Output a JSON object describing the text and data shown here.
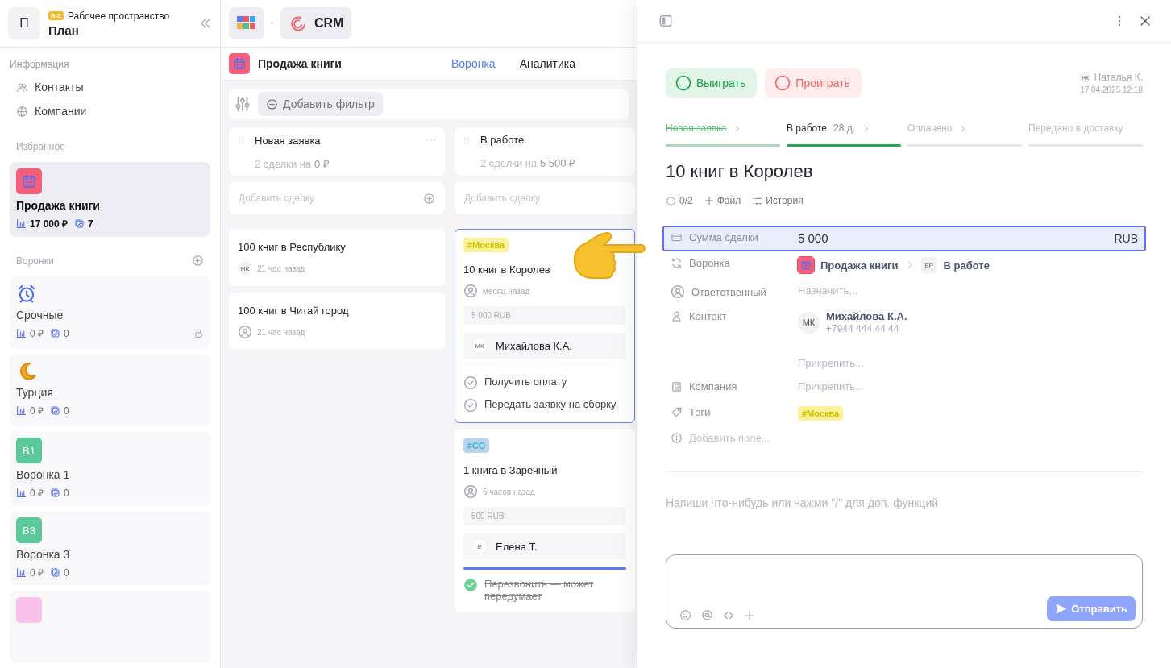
{
  "sidebar": {
    "workspace": {
      "avatar": "П",
      "badge": "BIZ",
      "label": "Рабочее пространство",
      "name": "План"
    },
    "info": {
      "title": "Информация",
      "items": [
        {
          "label": "Контакты",
          "kind": "contacts"
        },
        {
          "label": "Компании",
          "kind": "companies"
        }
      ]
    },
    "favorites": {
      "title": "Избранное",
      "items": [
        {
          "name": "Продажа книги",
          "kind": "calendar",
          "amount": "17 000 ₽",
          "count": "7",
          "selected": true,
          "locked": false
        }
      ]
    },
    "funnels": {
      "title": "Воронки",
      "items": [
        {
          "name": "Срочные",
          "kind": "alarm",
          "amount": "0 ₽",
          "count": "0",
          "selected": false,
          "locked": true
        },
        {
          "name": "Турция",
          "kind": "moon",
          "amount": "0 ₽",
          "count": "0",
          "selected": false,
          "locked": false
        },
        {
          "name": "Воронка 1",
          "kind": "badge",
          "badge": "В1",
          "color": "#5cc99a",
          "amount": "0 ₽",
          "count": "0",
          "selected": false,
          "locked": false
        },
        {
          "name": "Воронка 3",
          "kind": "badge",
          "badge": "В3",
          "color": "#5cc99a",
          "amount": "0 ₽",
          "count": "0",
          "selected": false,
          "locked": false
        },
        {
          "kind": "badge",
          "color": "#f9c0ec"
        }
      ]
    }
  },
  "topbar": {
    "crumb": "CRM"
  },
  "board": {
    "title": "Продажа книги",
    "tabs": [
      {
        "label": "Воронка",
        "selected": true
      },
      {
        "label": "Аналитика",
        "selected": false
      }
    ],
    "filter": "Добавить фильтр",
    "columns": [
      {
        "title": "Новая заявка",
        "summary": "2 сделки на **0 ₽**",
        "add": "Добавить сделку",
        "cards": [
          {
            "title": "100 книг в Республику",
            "initials": "НК",
            "time": "21 час назад",
            "selected": false
          },
          {
            "title": "100 книг в Читай город",
            "time": "21 час назад",
            "selected": false
          }
        ]
      },
      {
        "title": "В работе",
        "summary": "2 сделки на **5 500 ₽**",
        "add": "Добавить сделку",
        "cards": [
          {
            "tag": {
              "label": "#Москва",
              "color": "#fff09a"
            },
            "title": "10 книг в Королев",
            "time": "месяц назад",
            "amount": "5 000 RUB",
            "assignee": {
              "initials": "МК",
              "name": "Михайлова К.А."
            },
            "tasks": [
              {
                "label": "Получить оплату",
                "done": false
              },
              {
                "label": "Передать заявку на сборку",
                "done": false
              }
            ],
            "selected": true
          },
          {
            "tag": {
              "label": "#СО",
              "color": "#b8d4ee"
            },
            "title": "1 книга в Заречный",
            "time": "5 часов назад",
            "amount": "500 RUB",
            "assignee": {
              "initials": "Е",
              "name": "Елена Т."
            },
            "level": 1,
            "tasks": [
              {
                "label": "Перезвонить — может передумает",
                "done": true
              }
            ],
            "selected": false
          }
        ]
      }
    ]
  },
  "detail": {
    "actions": [
      {
        "label": "Выиграть",
        "kind": "win"
      },
      {
        "label": "Проиграть",
        "kind": "lose"
      }
    ],
    "author": {
      "initials": "НК",
      "name": "Наталья К.",
      "date": "17.04.2025 12:18"
    },
    "stages": [
      {
        "label": "Новая заявка",
        "done": true,
        "selected": false
      },
      {
        "label": "В работе",
        "duration": "28 д.",
        "done": false,
        "selected": true
      },
      {
        "label": "Оплачено",
        "done": false,
        "selected": false
      },
      {
        "label": "Передано в доставку",
        "done": false,
        "selected": false
      }
    ],
    "title": "10 книг в Королев",
    "meta": {
      "checklist": "0/2",
      "file": "Файл",
      "history": "История"
    },
    "fields": [
      {
        "kind": "amount",
        "label": "Сумма сделки",
        "value": "5 000",
        "currency": "RUB",
        "selected": true
      },
      {
        "kind": "funnel",
        "label": "Воронка",
        "funnel": "Продажа книги",
        "stage_initials": "ВР",
        "stage": "В работе",
        "selected": false
      },
      {
        "kind": "responsible",
        "label": "Ответственный",
        "placeholder": "Назначить...",
        "selected": false
      },
      {
        "kind": "contact",
        "label": "Контакт",
        "initials": "МК",
        "name": "Михайлова К.А.",
        "phone": "+7944 444 44 44",
        "attach": "Прикрепить...",
        "selected": false
      },
      {
        "kind": "company",
        "label": "Компания",
        "placeholder": "Прикрепить..",
        "selected": false
      },
      {
        "kind": "tags",
        "label": "Теги",
        "tag": {
          "label": "#Москва",
          "color": "#fff09a"
        },
        "selected": false
      },
      {
        "kind": "add",
        "label": "Добавить поле...",
        "selected": false
      }
    ],
    "comment_hint": "Напиши что-нибудь или нажми \"/\" для доп. функций",
    "send": "Отправить"
  }
}
